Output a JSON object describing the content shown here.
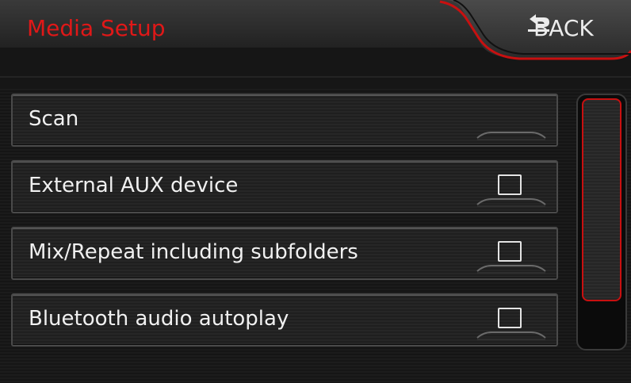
{
  "header": {
    "title": "Media Setup",
    "back_label": "BACK"
  },
  "menu": {
    "items": [
      {
        "label": "Scan",
        "type": "action"
      },
      {
        "label": "External AUX device",
        "type": "checkbox",
        "checked": false
      },
      {
        "label": "Mix/Repeat including subfolders",
        "type": "checkbox",
        "checked": false
      },
      {
        "label": "Bluetooth audio autoplay",
        "type": "checkbox",
        "checked": false
      }
    ]
  },
  "icons": {
    "back": "return-arrow-icon",
    "checkbox": "checkbox-unchecked-icon"
  },
  "colors": {
    "accent": "#e01818",
    "text": "#f0f0f0",
    "background": "#181818"
  }
}
